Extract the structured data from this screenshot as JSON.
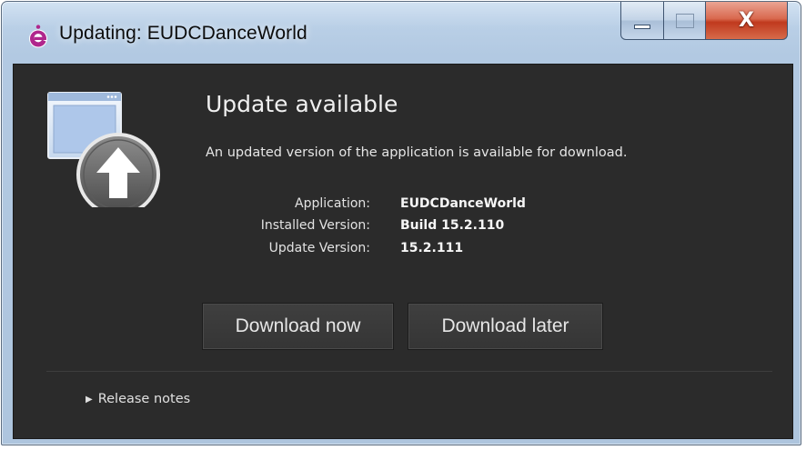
{
  "window": {
    "title": "Updating: EUDCDanceWorld",
    "controls": {
      "minimize_icon": "minimize-icon",
      "maximize_icon": "maximize-icon",
      "close_glyph": "X"
    }
  },
  "content": {
    "icon": "update-arrow-icon",
    "heading": "Update available",
    "description": "An updated version of the application is available for download.",
    "info": [
      {
        "label": "Application:",
        "value": "EUDCDanceWorld"
      },
      {
        "label": "Installed Version:",
        "value": "Build 15.2.110"
      },
      {
        "label": "Update Version:",
        "value": "15.2.111"
      }
    ],
    "buttons": {
      "download_now": "Download now",
      "download_later": "Download later"
    },
    "release_notes": {
      "label": "Release notes",
      "arrow_icon": "disclosure-arrow-icon"
    }
  },
  "colors": {
    "client_background": "#2b2b2b",
    "title_bar": "#b9cfe6",
    "close_button": "#c0391e",
    "text": "#e6e6e6"
  }
}
